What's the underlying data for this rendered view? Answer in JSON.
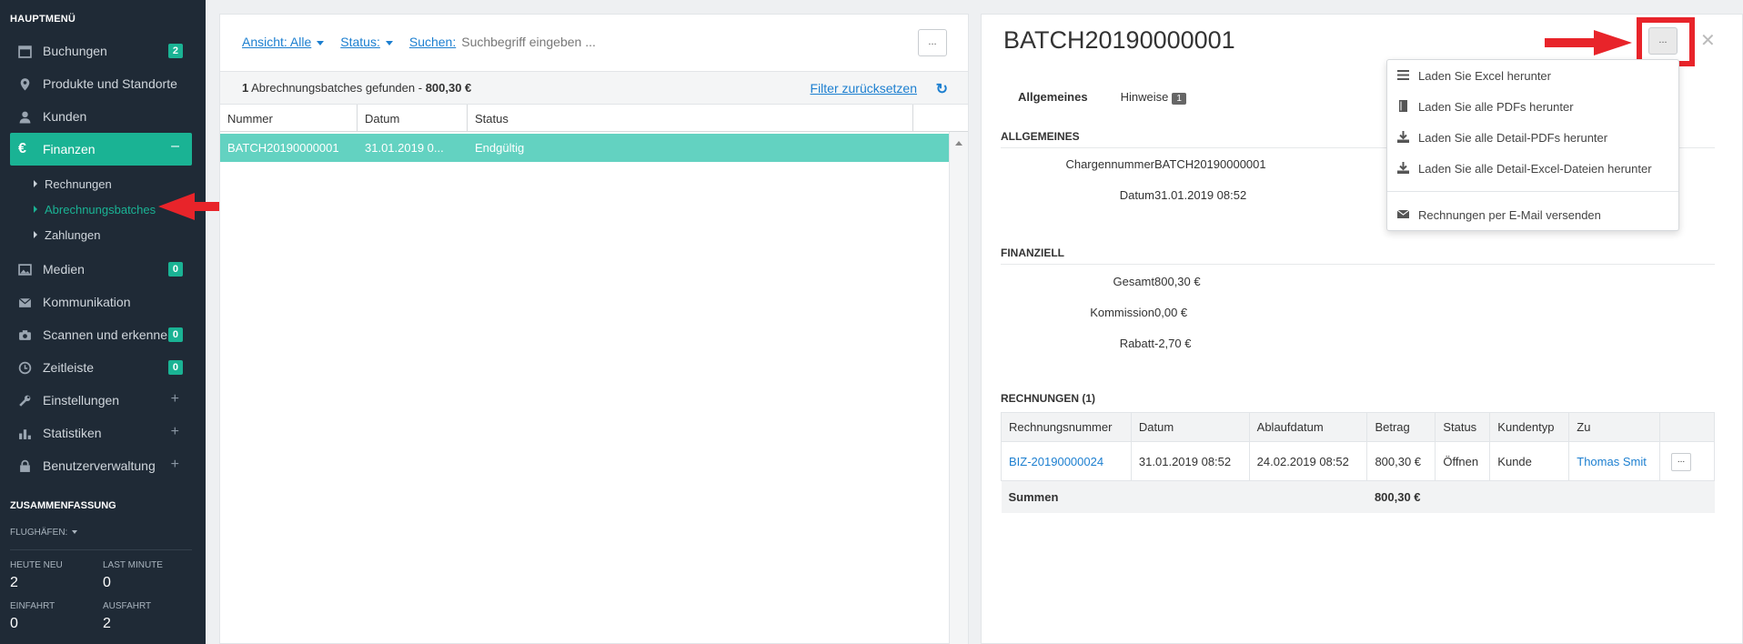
{
  "sidebar": {
    "heading": "HAUPTMENÜ",
    "items": [
      {
        "label": "Buchungen",
        "badge": "2"
      },
      {
        "label": "Produkte und Standorte"
      },
      {
        "label": "Kunden"
      },
      {
        "label": "Finanzen"
      },
      {
        "label": "Medien",
        "badge": "0"
      },
      {
        "label": "Kommunikation"
      },
      {
        "label": "Scannen und erkennen",
        "badge": "0"
      },
      {
        "label": "Zeitleiste",
        "badge": "0"
      },
      {
        "label": "Einstellungen"
      },
      {
        "label": "Statistiken"
      },
      {
        "label": "Benutzerverwaltung"
      }
    ],
    "subitems": [
      {
        "label": "Rechnungen"
      },
      {
        "label": "Abrechnungsbatches"
      },
      {
        "label": "Zahlungen"
      }
    ],
    "summary": {
      "heading": "ZUSAMMENFASSUNG",
      "airports": "FLUGHÄFEN:",
      "stats": [
        {
          "label": "HEUTE NEU",
          "value": "2"
        },
        {
          "label": "LAST MINUTE",
          "value": "0"
        },
        {
          "label": "EINFAHRT",
          "value": "0"
        },
        {
          "label": "AUSFAHRT",
          "value": "2"
        }
      ]
    }
  },
  "list": {
    "view_label": "Ansicht: Alle",
    "status_label": "Status:",
    "search_label": "Suchen:",
    "search_placeholder": "Suchbegriff eingeben ...",
    "more_button": "...",
    "result_count": "1",
    "result_text": "Abrechnungsbatches gefunden -",
    "result_total": "800,30 €",
    "reset_filter": "Filter zurücksetzen",
    "columns": [
      "Nummer",
      "Datum",
      "Status"
    ],
    "rows": [
      {
        "number": "BATCH20190000001",
        "date": "31.01.2019 0...",
        "status": "Endgültig"
      }
    ]
  },
  "detail": {
    "title": "BATCH20190000001",
    "tabs": [
      {
        "label": "Allgemeines"
      },
      {
        "label": "Hinweise",
        "count": "1"
      }
    ],
    "general": {
      "heading": "ALLGEMEINES",
      "fields": [
        {
          "key": "Chargennummer",
          "value": "BATCH20190000001"
        },
        {
          "key": "Datum",
          "value": "31.01.2019 08:52"
        }
      ]
    },
    "financial": {
      "heading": "FINANZIELL",
      "fields": [
        {
          "key": "Gesamt",
          "value": "800,30 €"
        },
        {
          "key": "Kommission",
          "value": "0,00 €"
        },
        {
          "key": "Rabatt",
          "value": "-2,70 €"
        }
      ]
    },
    "invoices": {
      "heading": "RECHNUNGEN (1)",
      "columns": [
        "Rechnungsnummer",
        "Datum",
        "Ablaufdatum",
        "Betrag",
        "Status",
        "Kundentyp",
        "Zu"
      ],
      "rows": [
        {
          "number": "BIZ-20190000024",
          "date": "31.01.2019 08:52",
          "due": "24.02.2019 08:52",
          "amount": "800,30 €",
          "status": "Öffnen",
          "type": "Kunde",
          "to": "Thomas Smit"
        }
      ],
      "sum_label": "Summen",
      "sum_value": "800,30 €"
    },
    "menu": [
      {
        "label": "Laden Sie Excel herunter",
        "icon": "list-icon"
      },
      {
        "label": "Laden Sie alle PDFs herunter",
        "icon": "book-icon"
      },
      {
        "label": "Laden Sie alle Detail-PDFs herunter",
        "icon": "download-icon"
      },
      {
        "label": "Laden Sie alle Detail-Excel-Dateien herunter",
        "icon": "download-icon"
      },
      {
        "label": "Rechnungen per E-Mail versenden",
        "icon": "envelope-icon"
      }
    ]
  },
  "colors": {
    "accent": "#1ab394",
    "selected_row": "#63d2c1",
    "sidebar_bg": "#1f2a36",
    "link": "#1c7fd0",
    "annotation_red": "#e8242a"
  }
}
